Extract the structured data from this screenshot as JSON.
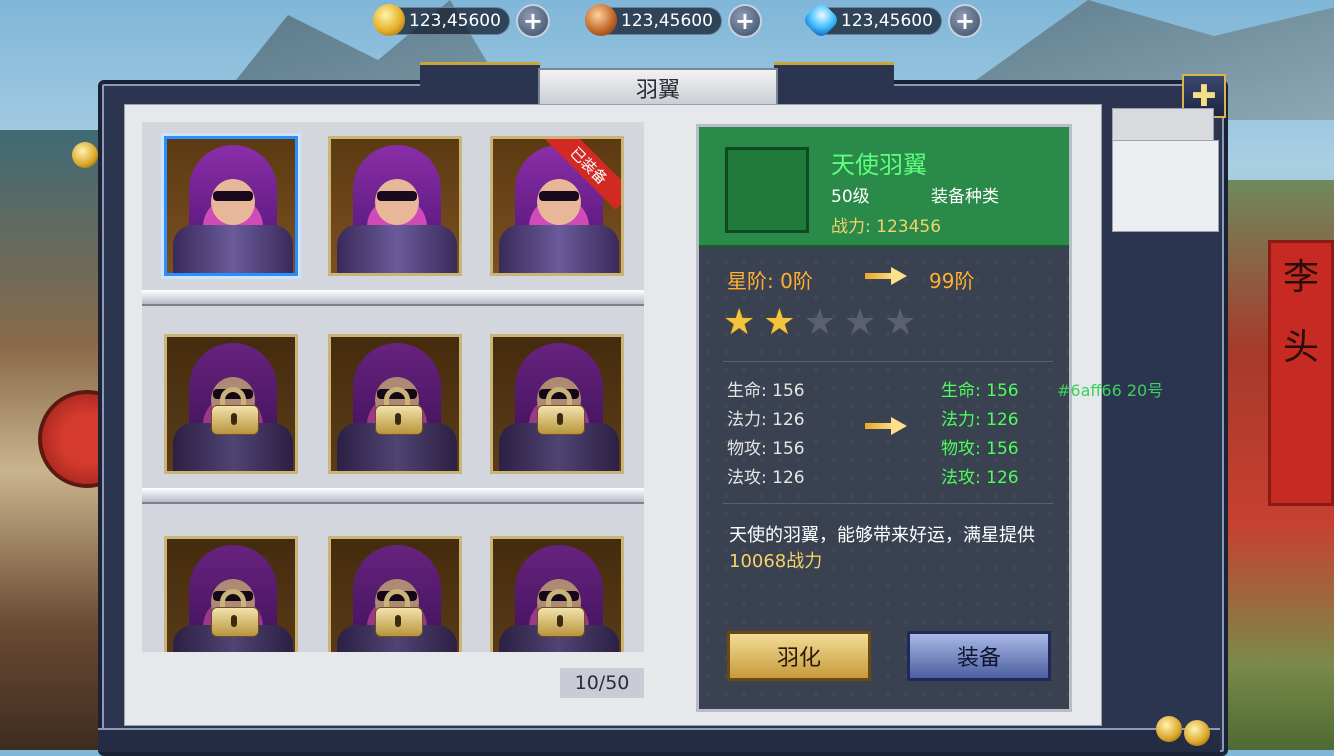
{
  "currencies": [
    {
      "icon": "gold-coin-icon",
      "value": "123,45600",
      "add": "+"
    },
    {
      "icon": "bronze-coin-icon",
      "value": "123,45600",
      "add": "+"
    },
    {
      "icon": "diamond-icon",
      "value": "123,45600",
      "add": "+"
    }
  ],
  "window": {
    "title": "羽翼",
    "close": "✚"
  },
  "grid": {
    "equipped_tag": "已装备",
    "page": "10/50",
    "slots": [
      {
        "state": "selected"
      },
      {
        "state": "owned"
      },
      {
        "state": "equipped"
      },
      {
        "state": "locked"
      },
      {
        "state": "locked"
      },
      {
        "state": "locked"
      },
      {
        "state": "locked"
      },
      {
        "state": "locked"
      },
      {
        "state": "locked"
      }
    ]
  },
  "detail": {
    "name": "天使羽翼",
    "level": "50级",
    "type": "装备种类",
    "power": "战力: 123456",
    "star_label": "星阶: 0阶",
    "star_max": "99阶",
    "stars_filled": 2,
    "stars_total": 5,
    "stats_current": [
      "生命: 156",
      "法力: 126",
      "物攻: 156",
      "法攻: 126"
    ],
    "stats_next": [
      "生命: 156",
      "法力: 126",
      "物攻: 156",
      "法攻: 126"
    ],
    "debug_note": "#6aff66  20号",
    "desc_main": "天使的羽翼，能够带来好运，满星提供 ",
    "desc_highlight": "10068战力",
    "btn_upgrade": "羽化",
    "btn_equip": "装备"
  },
  "colors": {
    "accent_green": "#5dff7a",
    "stat_green": "#4dff5a",
    "gold": "#f4d36a",
    "orange": "#ffb030"
  }
}
